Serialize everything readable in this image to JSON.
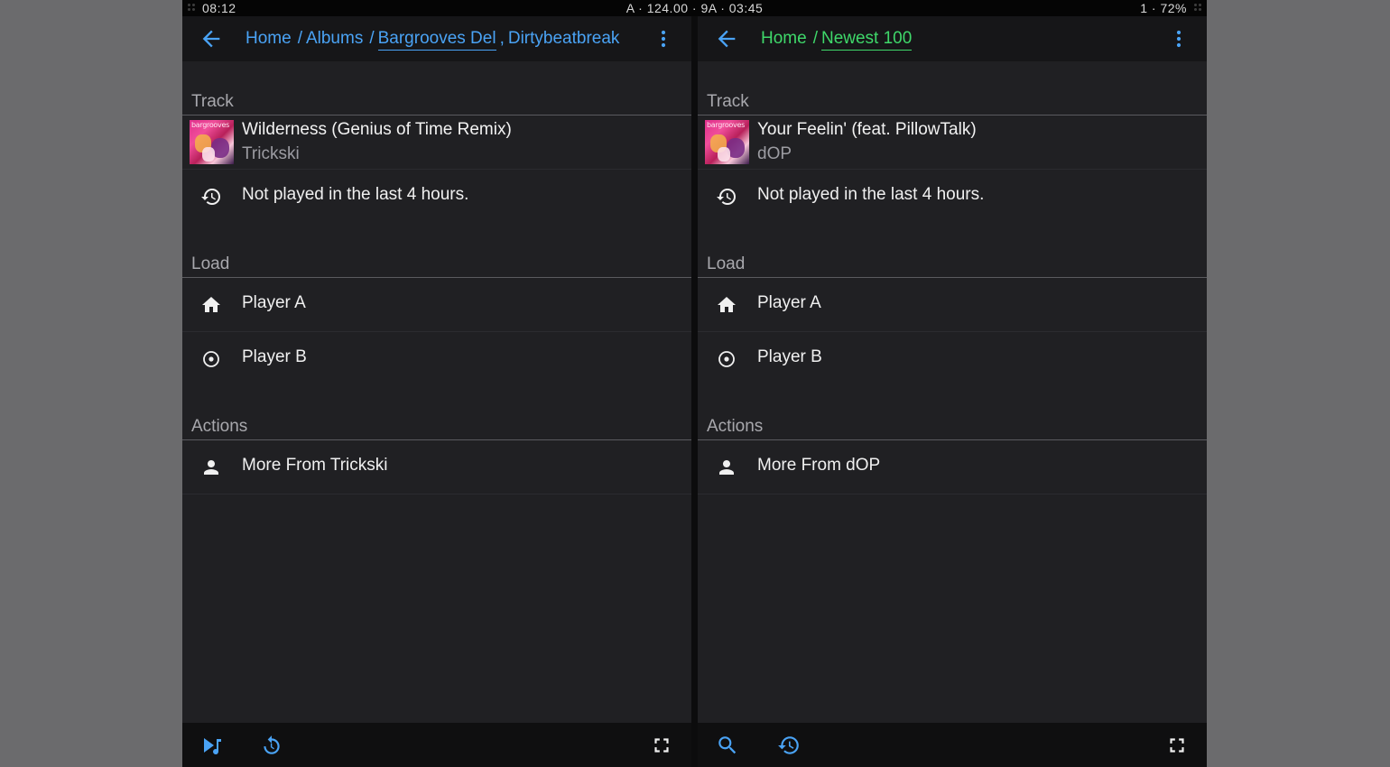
{
  "statusbar": {
    "time": "08:12",
    "center": "A · 124.00 · 9A · 03:45",
    "right": "1 · 72%"
  },
  "colors": {
    "accent_left": "#4aa3f5",
    "accent_right": "#3fd86a",
    "background": "#202023",
    "header": "#161618"
  },
  "left_pane": {
    "breadcrumb": {
      "home": "Home",
      "sep1": "/",
      "albums": "Albums",
      "sep2": "/",
      "album": "Bargrooves Del",
      "sep3": ",",
      "artist": "Dirtybeatbreak"
    },
    "sections": {
      "track": "Track",
      "load": "Load",
      "actions": "Actions"
    },
    "track": {
      "title": "Wilderness (Genius of Time Remix)",
      "artist": "Trickski",
      "art_text": "bargrooves"
    },
    "history_note": "Not played in the last 4 hours.",
    "load_items": [
      "Player A",
      "Player B"
    ],
    "action_items": [
      "More From Trickski"
    ],
    "footer_icons": [
      "queue-play-icon",
      "refresh-icon",
      "fullscreen-icon"
    ]
  },
  "right_pane": {
    "breadcrumb": {
      "home": "Home",
      "sep1": "/",
      "current": "Newest 100"
    },
    "sections": {
      "track": "Track",
      "load": "Load",
      "actions": "Actions"
    },
    "track": {
      "title": "Your Feelin' (feat. PillowTalk)",
      "artist": "dOP",
      "art_text": "bargrooves"
    },
    "history_note": "Not played in the last 4 hours.",
    "load_items": [
      "Player A",
      "Player B"
    ],
    "action_items": [
      "More From dOP"
    ],
    "footer_icons": [
      "search-icon",
      "history-icon",
      "fullscreen-icon"
    ]
  }
}
